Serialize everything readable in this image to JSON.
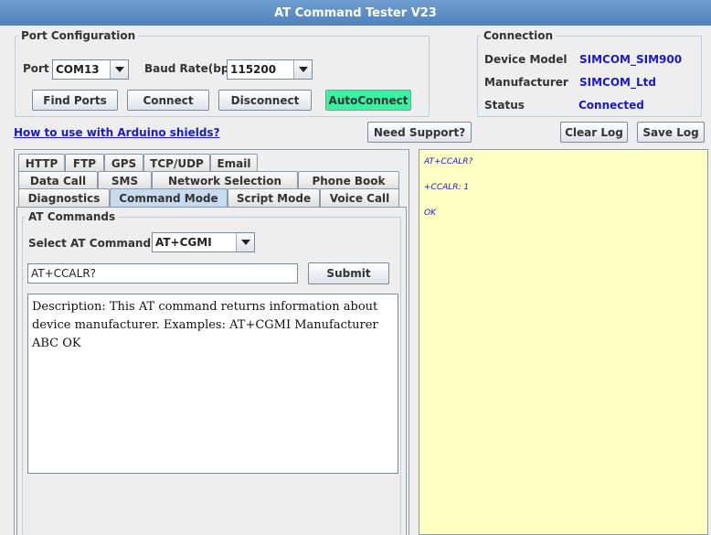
{
  "window": {
    "title": "AT Command Tester V23"
  },
  "port_config": {
    "legend": "Port Configuration",
    "port_label": "Port",
    "port_value": "COM13",
    "baud_label": "Baud Rate(bps)",
    "baud_value": "115200",
    "buttons": {
      "find_ports": "Find Ports",
      "connect": "Connect",
      "disconnect": "Disconnect",
      "autoconnect": "AutoConnect"
    }
  },
  "connection": {
    "legend": "Connection",
    "device_model_label": "Device Model",
    "device_model_value": "SIMCOM_SIM900",
    "manufacturer_label": "Manufacturer",
    "manufacturer_value": "SIMCOM_Ltd",
    "status_label": "Status",
    "status_value": "Connected"
  },
  "toolbar": {
    "arduino_link": "How to use with Arduino shields?",
    "need_support": "Need Support?",
    "clear_log": "Clear Log",
    "save_log": "Save Log"
  },
  "tabs": {
    "row1": [
      "HTTP",
      "FTP",
      "GPS",
      "TCP/UDP",
      "Email"
    ],
    "row2": [
      "Data Call",
      "SMS",
      "Network Selection",
      "Phone Book"
    ],
    "row3": [
      "Diagnostics",
      "Command Mode",
      "Script Mode",
      "Voice Call"
    ],
    "active": "Command Mode"
  },
  "at_commands": {
    "legend": "AT Commands",
    "select_label": "Select AT Command",
    "select_value": "AT+CGMI",
    "input_value": "AT+CCALR?",
    "submit": "Submit",
    "description": "Description: This AT command returns information about device manufacturer. Examples: AT+CGMI Manufacturer ABC OK"
  },
  "log": {
    "lines": [
      "AT+CCALR?",
      "+CCALR: 1",
      "OK"
    ]
  },
  "colors": {
    "titlebar": "#5a8dc5",
    "link": "#1a1ac8",
    "autoconnect": "#35f3a0",
    "log_background": "#ffffc4",
    "active_tab": "#c6daf0"
  }
}
